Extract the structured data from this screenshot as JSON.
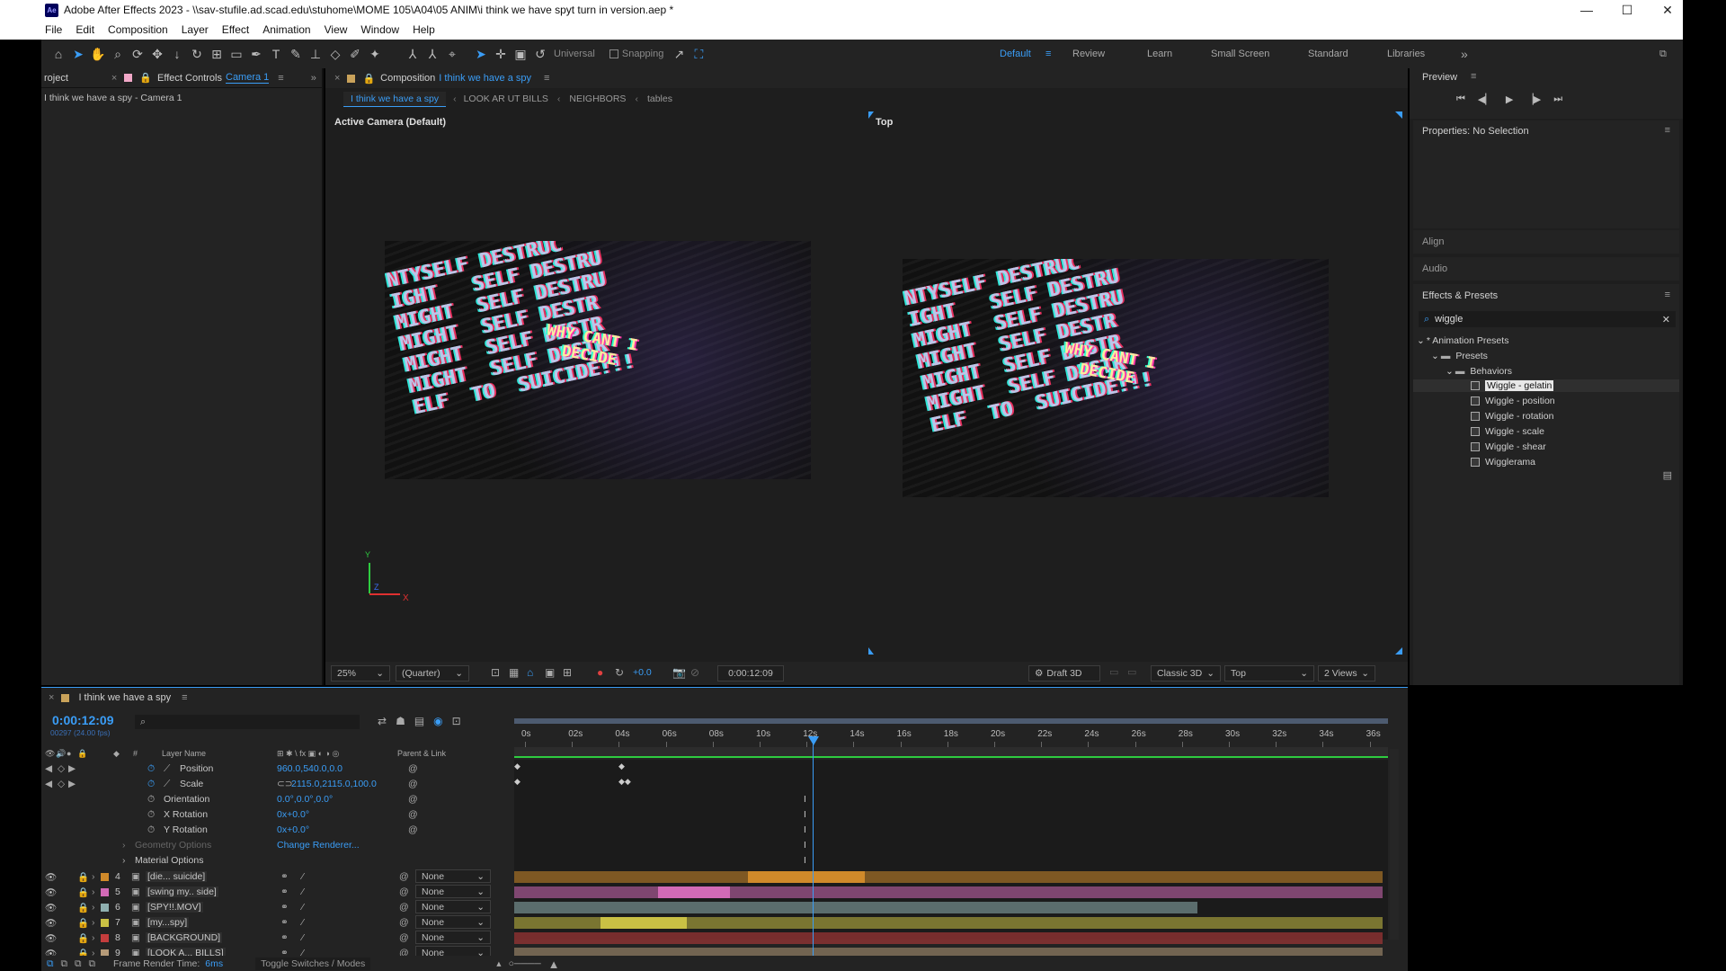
{
  "window": {
    "title": "Adobe After Effects 2023 - \\\\sav-stufile.ad.scad.edu\\stuhome\\MOME 105\\A04\\05 ANIM\\i think we have spyt turn in version.aep *",
    "app_icon": "Ae",
    "controls": [
      "—",
      "☐",
      "✕"
    ]
  },
  "menu": [
    "File",
    "Edit",
    "Composition",
    "Layer",
    "Effect",
    "Animation",
    "View",
    "Window",
    "Help"
  ],
  "toolbar": {
    "universal_label": "Universal",
    "snapping_label": "Snapping",
    "workspaces": [
      "Default",
      "Review",
      "Learn",
      "Small Screen",
      "Standard",
      "Libraries"
    ],
    "more": "»"
  },
  "left_panel": {
    "project_tab": "roject",
    "effect_controls_tab": "Effect Controls",
    "effect_controls_target": "Camera 1",
    "subtitle": "I think we have a spy - Camera 1"
  },
  "composition": {
    "tab_label": "Composition",
    "tab_name": "I think we have a spy",
    "breadcrumbs": [
      "I think we have a spy",
      "LOOK AR UT BILLS",
      "NEIGHBORS",
      "tables"
    ],
    "left_view_label": "Active Camera (Default)",
    "right_view_label": "Top",
    "overlay_lines": [
      "NTYSELF DESTRUC",
      "IGHT   SELF DESTRU",
      "MIGHT  SELF DESTRU",
      "MIGHT  SELF DESTR",
      "MIGHT  SELF DESTR",
      "MIGHT  SELF DESTR",
      "ELF  TO  SUICIDE!!!"
    ],
    "overlay_center": "WHY CANT I\n  DECIDE",
    "axis": {
      "y": "Y",
      "x": "X",
      "z": "Z"
    },
    "footer": {
      "zoom": "25%",
      "resolution": "(Quarter)",
      "exposure": "+0.0",
      "timecode": "0:00:12:09",
      "draft3d": "Draft 3D",
      "renderer": "Classic 3D",
      "view": "Top",
      "views": "2 Views"
    }
  },
  "right_panel": {
    "preview_title": "Preview",
    "properties_title": "Properties: No Selection",
    "align": "Align",
    "audio": "Audio",
    "effects_presets": "Effects & Presets",
    "search_value": "wiggle",
    "tree": {
      "root": "* Animation Presets",
      "presets": "Presets",
      "behaviors": "Behaviors",
      "items": [
        "Wiggle - gelatin",
        "Wiggle - position",
        "Wiggle - rotation",
        "Wiggle - scale",
        "Wiggle - shear",
        "Wigglerama"
      ]
    }
  },
  "timeline": {
    "tab_name": "I think we have a spy",
    "timecode": "0:00:12:09",
    "frame_info": "00297 (24.00 fps)",
    "columns": {
      "num": "#",
      "layer_name": "Layer Name",
      "parent": "Parent & Link"
    },
    "ruler": [
      "0s",
      "02s",
      "04s",
      "06s",
      "08s",
      "10s",
      "12s",
      "14s",
      "16s",
      "18s",
      "20s",
      "22s",
      "24s",
      "26s",
      "28s",
      "30s",
      "32s",
      "34s",
      "36s"
    ],
    "properties": [
      {
        "name": "Position",
        "value": "960.0,540.0,0.0"
      },
      {
        "name": "Scale",
        "value": "2115.0,2115.0,100.0"
      },
      {
        "name": "Orientation",
        "value": "0.0°,0.0°,0.0°"
      },
      {
        "name": "X Rotation",
        "value": "0x+0.0°"
      },
      {
        "name": "Y Rotation",
        "value": "0x+0.0°"
      },
      {
        "name": "Geometry Options",
        "value": "Change Renderer..."
      },
      {
        "name": "Material Options",
        "value": ""
      }
    ],
    "layers": [
      {
        "num": "4",
        "name": "[die... suicide]",
        "parent": "None",
        "color": "#d08a2a"
      },
      {
        "num": "5",
        "name": "[swing my.. side]",
        "parent": "None",
        "color": "#d26ab6"
      },
      {
        "num": "6",
        "name": "[SPY!!.MOV]",
        "parent": "None",
        "color": "#8fb0b0"
      },
      {
        "num": "7",
        "name": "[my...spy]",
        "parent": "None",
        "color": "#c9c044"
      },
      {
        "num": "8",
        "name": "[BACKGROUND]",
        "parent": "None",
        "color": "#c43d3d"
      },
      {
        "num": "9",
        "name": "[LOOK A... BILLS]",
        "parent": "None",
        "color": "#b59a78"
      }
    ],
    "footer": {
      "render_time_label": "Frame Render Time:",
      "render_time_value": "6ms",
      "toggle": "Toggle Switches / Modes"
    }
  }
}
